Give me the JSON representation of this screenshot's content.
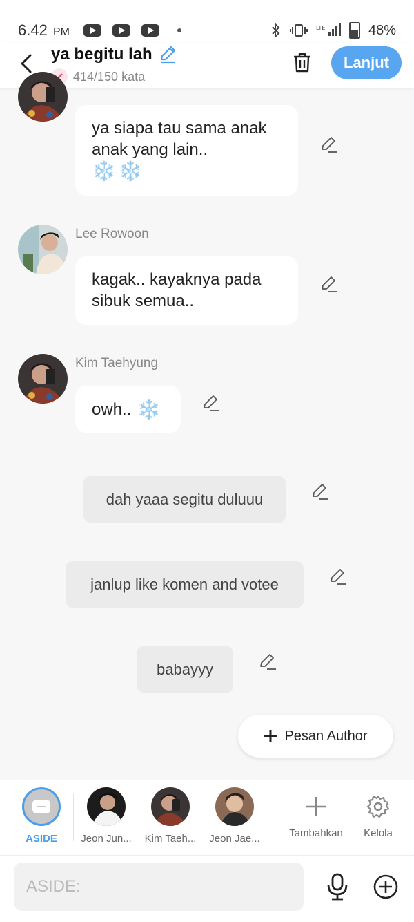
{
  "status_bar": {
    "time": "6.42",
    "ampm": "PM",
    "battery": "48%"
  },
  "header": {
    "title": "ya begitu lah",
    "word_count": "414/150 kata",
    "next_label": "Lanjut"
  },
  "messages": [
    {
      "sender": "",
      "text": "ya siapa tau sama anak anak yang lain..",
      "emoji": "❄️❄️"
    },
    {
      "sender": "Lee Rowoon",
      "text": "kagak.. kayaknya pada sibuk semua..",
      "emoji": ""
    },
    {
      "sender": "Kim Taehyung",
      "text": "owh..",
      "emoji": "❄️"
    }
  ],
  "aside_messages": [
    {
      "text": "dah yaaa segitu duluuu"
    },
    {
      "text": "janlup like komen and votee"
    },
    {
      "text": "babayyy"
    }
  ],
  "author_button": {
    "label": "Pesan Author"
  },
  "characters": [
    {
      "label": "ASIDE"
    },
    {
      "label": "Jeon Jun..."
    },
    {
      "label": "Kim Taeh..."
    },
    {
      "label": "Jeon Jae..."
    }
  ],
  "actions": {
    "add_label": "Tambahkan",
    "manage_label": "Kelola"
  },
  "composer": {
    "placeholder": "ASIDE:"
  },
  "colors": {
    "accent": "#58a6f0",
    "aside_selected": "#4e9de8",
    "badge_pink": "#f25a7a"
  }
}
